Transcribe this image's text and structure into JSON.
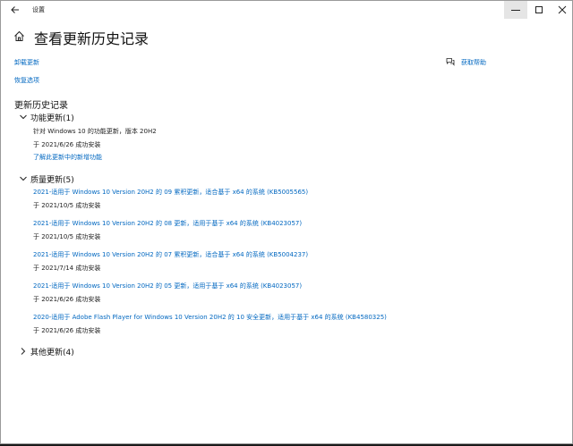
{
  "window": {
    "title": "设置"
  },
  "page": {
    "title": "查看更新历史记录"
  },
  "links": {
    "uninstall": "卸载更新",
    "recovery": "恢复选项",
    "help": "获取帮助"
  },
  "history": {
    "title": "更新历史记录",
    "feature": {
      "label": "功能更新(1)",
      "name": "针对 Windows 10 的功能更新，版本 20H2",
      "status": "于 2021/6/26 成功安装",
      "learn_more": "了解此更新中的新增功能"
    },
    "quality": {
      "label": "质量更新(5)",
      "items": [
        {
          "title": "2021-适用于 Windows 10 Version 20H2 的 09 累积更新，适合基于 x64 的系统 (KB5005565)",
          "status": "于 2021/10/5 成功安装"
        },
        {
          "title": "2021-适用于 Windows 10 Version 20H2 的 08 更新，适用于基于 x64 的系统 (KB4023057)",
          "status": "于 2021/10/5 成功安装"
        },
        {
          "title": "2021-适用于 Windows 10 Version 20H2 的 07 累积更新，适合基于 x64 的系统 (KB5004237)",
          "status": "于 2021/7/14 成功安装"
        },
        {
          "title": "2021-适用于 Windows 10 Version 20H2 的 05 更新，适用于基于 x64 的系统 (KB4023057)",
          "status": "于 2021/6/26 成功安装"
        },
        {
          "title": "2020-适用于 Adobe Flash Player for Windows 10 Version 20H2 的 10 安全更新，适用于基于 x64 的系统 (KB4580325)",
          "status": "于 2021/6/26 成功安装"
        }
      ]
    },
    "other": {
      "label": "其他更新(4)"
    }
  }
}
